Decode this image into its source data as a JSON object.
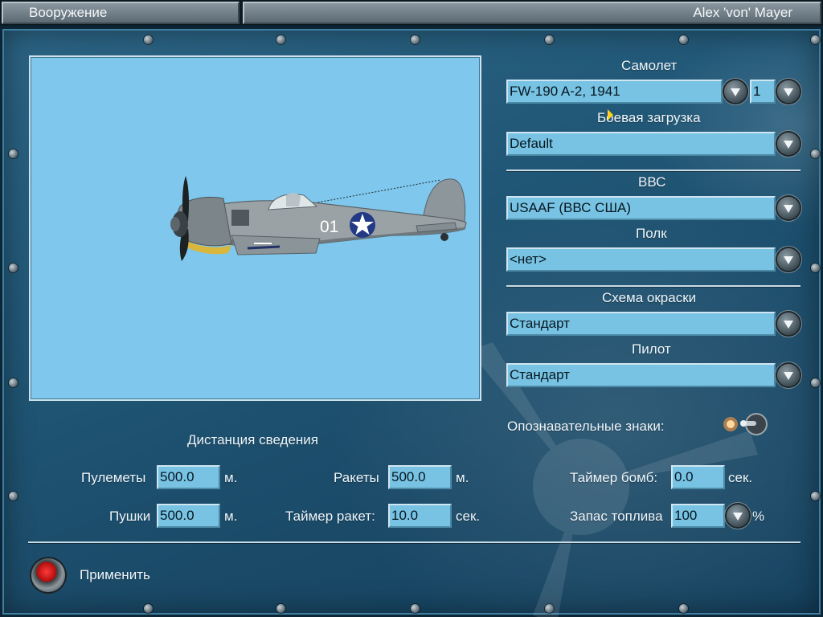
{
  "window": {
    "title": "Вооружение",
    "user": "Alex 'von' Mayer"
  },
  "aircraft": {
    "label": "Самолет",
    "value": "FW-190 A-2, 1941",
    "count": "1"
  },
  "loadout": {
    "label": "Боевая загрузка",
    "value": "Default"
  },
  "air_force": {
    "label": "ВВС",
    "value": "USAAF (ВВС США)"
  },
  "regiment": {
    "label": "Полк",
    "value": "<нет>"
  },
  "paint_scheme": {
    "label": "Схема окраски",
    "value": "Стандарт"
  },
  "pilot": {
    "label": "Пилот",
    "value": "Стандарт"
  },
  "markings": {
    "label": "Опознавательные знаки:",
    "enabled": true
  },
  "aircraft_tail_number": "01",
  "convergence": {
    "heading": "Дистанция сведения",
    "machine_guns": {
      "label": "Пулеметы",
      "value": "500.0",
      "unit": "м."
    },
    "cannons": {
      "label": "Пушки",
      "value": "500.0",
      "unit": "м."
    },
    "rockets": {
      "label": "Ракеты",
      "value": "500.0",
      "unit": "м."
    },
    "rocket_timer": {
      "label": "Таймер ракет:",
      "value": "10.0",
      "unit": "сек."
    },
    "bomb_timer": {
      "label": "Таймер бомб:",
      "value": "0.0",
      "unit": "сек."
    },
    "fuel": {
      "label": "Запас топлива",
      "value": "100",
      "unit": "%"
    }
  },
  "apply": {
    "label": "Применить"
  },
  "colors": {
    "panel": "#205675",
    "field": "#78c2e3",
    "preview_sky": "#7fc7ec"
  }
}
